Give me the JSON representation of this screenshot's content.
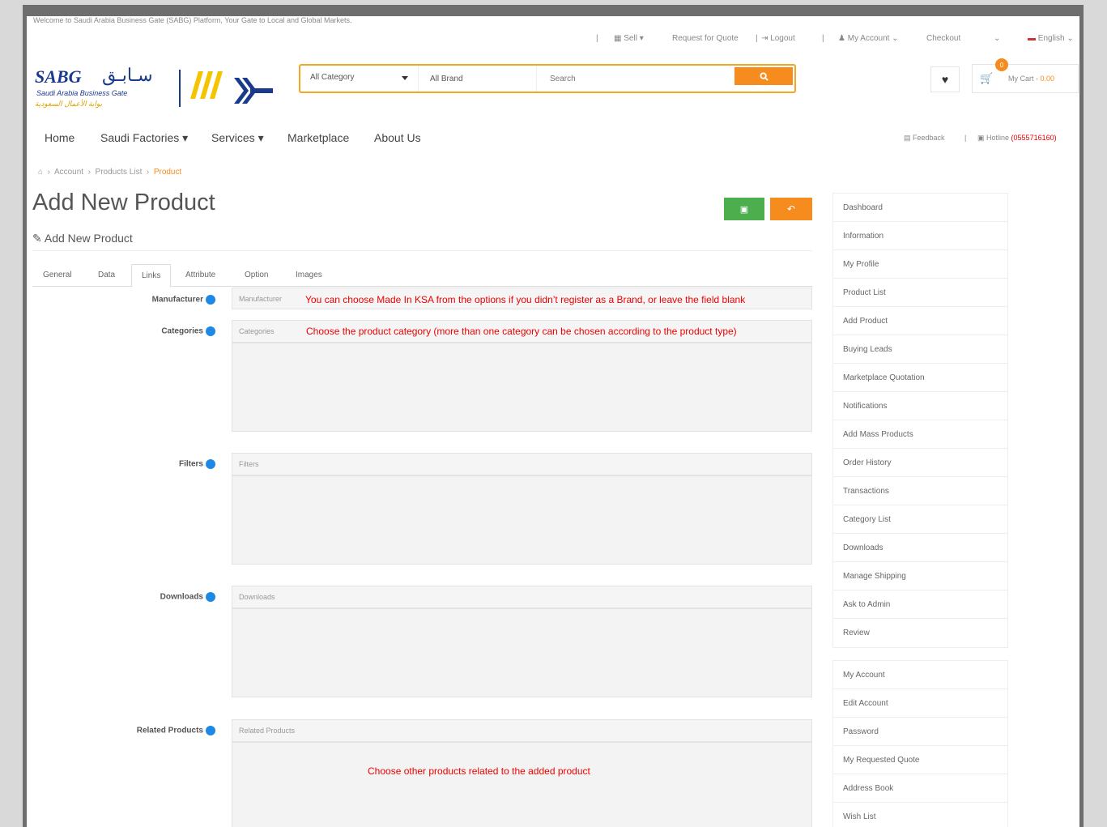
{
  "header": {
    "welcome": "Welcome to Saudi Arabia Business Gate (SABG) Platform, Your Gate to Local and Global Markets.",
    "sell": "Sell",
    "request_quote": "Request for Quote",
    "logout": "Logout",
    "my_account": "My Account",
    "checkout": "Checkout",
    "language": "English"
  },
  "logo": {
    "name": "SABG",
    "arabic": "سـابـق",
    "subtitle": "Saudi Arabia Business Gate",
    "subtitle_ar": "بوابة الأعمال السعودية"
  },
  "search": {
    "category": "All Category",
    "brand": "All Brand",
    "placeholder": "Search"
  },
  "cart": {
    "count": "0",
    "label": "My Cart - ",
    "amount": "0.00"
  },
  "nav": {
    "items": [
      "Home",
      "Saudi Factories",
      "Services",
      "Marketplace",
      "About Us"
    ],
    "feedback": "Feedback",
    "hotline_label": "Hotline",
    "hotline_number": "(0555716160)"
  },
  "breadcrumb": {
    "items": [
      "Account",
      "Products List",
      "Product"
    ]
  },
  "page": {
    "title": "Add New Product",
    "subtitle": "Add New Product"
  },
  "tabs": [
    "General",
    "Data",
    "Links",
    "Attribute",
    "Option",
    "Images"
  ],
  "active_tab": "Links",
  "fields": {
    "manufacturer": {
      "label": "Manufacturer",
      "placeholder": "Manufacturer"
    },
    "categories": {
      "label": "Categories",
      "placeholder": "Categories"
    },
    "filters": {
      "label": "Filters",
      "placeholder": "Filters"
    },
    "downloads": {
      "label": "Downloads",
      "placeholder": "Downloads"
    },
    "related": {
      "label": "Related Products",
      "placeholder": "Related Products"
    }
  },
  "notes": {
    "manufacturer": "You can choose Made In KSA from the options if you didn’t register as a Brand, or leave the field blank",
    "categories": "Choose the product category (more than one category can be chosen according to the product type)",
    "related": "Choose other products related to the added product"
  },
  "sidebar": {
    "group1": [
      "Dashboard",
      "Information",
      "My Profile",
      "Product List",
      "Add Product",
      "Buying Leads",
      "Marketplace Quotation",
      "Notifications",
      "Add Mass Products",
      "Order History",
      "Transactions",
      "Category List",
      "Downloads",
      "Manage Shipping",
      "Ask to Admin",
      "Review"
    ],
    "group2": [
      "My Account",
      "Edit Account",
      "Password",
      "My Requested Quote",
      "Address Book",
      "Wish List"
    ]
  },
  "colors": {
    "accent": "#f68b1e",
    "save": "#4cae4c",
    "note": "#e00000",
    "brand_blue": "#1a3a8c",
    "info_dot": "#1e88e5"
  }
}
